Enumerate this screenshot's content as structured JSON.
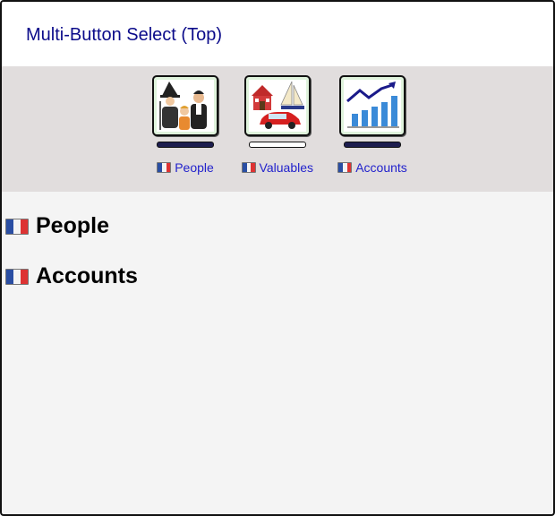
{
  "window": {
    "title": "Multi-Button Select (Top)"
  },
  "buttons": [
    {
      "label": "People",
      "icon": "family-icon",
      "selected": true
    },
    {
      "label": "Valuables",
      "icon": "house-boat-car-icon",
      "selected": false
    },
    {
      "label": "Accounts",
      "icon": "growth-chart-icon",
      "selected": true
    }
  ],
  "sections": [
    {
      "heading": "People"
    },
    {
      "heading": "Accounts"
    }
  ],
  "colors": {
    "title": "#0b0b8a",
    "toolbar_bg": "#e1dddd",
    "tile_bg": "#dff3dc",
    "selected_bar": "#1d1d4e",
    "link": "#2222cc"
  }
}
